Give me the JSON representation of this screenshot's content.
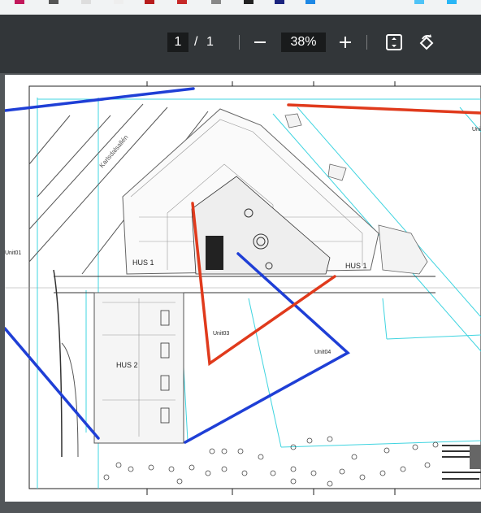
{
  "viewer": {
    "current_page": "1",
    "page_separator": "/",
    "total_pages": "1",
    "zoom": "38%"
  },
  "drawing": {
    "street_label": "Karlsdalsallén",
    "unit_labels": [
      "Unit01",
      "Unit03",
      "Unit04",
      "Uni"
    ],
    "building_labels": [
      "HUS 1",
      "HUS 1",
      "HUS 2"
    ]
  },
  "colors": {
    "toolbar": "#323639",
    "viewer_bg": "#525659",
    "red_line": "#e03a1c",
    "blue_line": "#1f3fd6",
    "cyan_line": "#3fd4e0"
  }
}
